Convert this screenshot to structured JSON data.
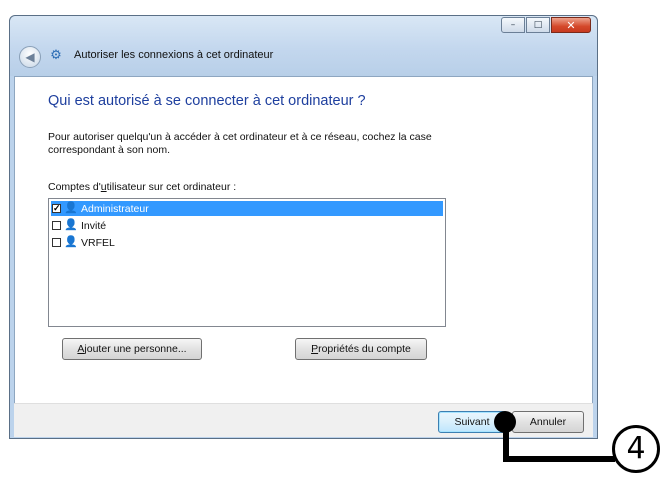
{
  "window": {
    "title": "Autoriser les connexions à cet ordinateur",
    "caption_buttons": {
      "minimize": "–",
      "maximize": "□",
      "close": "✕"
    }
  },
  "nav": {
    "back_icon": "back-arrow-icon",
    "back_glyph": "◀",
    "app_icon": "network-icon",
    "app_glyph": "⚙"
  },
  "main": {
    "heading": "Qui est autorisé à se connecter à cet ordinateur ?",
    "description": "Pour autoriser quelqu'un à accéder à cet ordinateur et à ce réseau, cochez la case correspondant à son nom.",
    "list_label_pre": "Comptes d'",
    "list_label_u": "u",
    "list_label_post": "tilisateur sur cet ordinateur :",
    "users": [
      {
        "name": "Administrateur",
        "checked": true,
        "selected": true
      },
      {
        "name": "Invité",
        "checked": false,
        "selected": false
      },
      {
        "name": "VRFEL",
        "checked": false,
        "selected": false
      }
    ],
    "user_icon_glyph": "👤",
    "add_person_u": "A",
    "add_person_rest": "jouter une personne...",
    "account_props_u": "P",
    "account_props_rest": "ropriétés du compte"
  },
  "footer": {
    "next_label": "Suivant",
    "cancel_label": "Annuler"
  },
  "callout": {
    "number": "4"
  },
  "colors": {
    "heading": "#1e3f9e",
    "selection": "#3399ff",
    "frame": "#bcd3ec"
  }
}
